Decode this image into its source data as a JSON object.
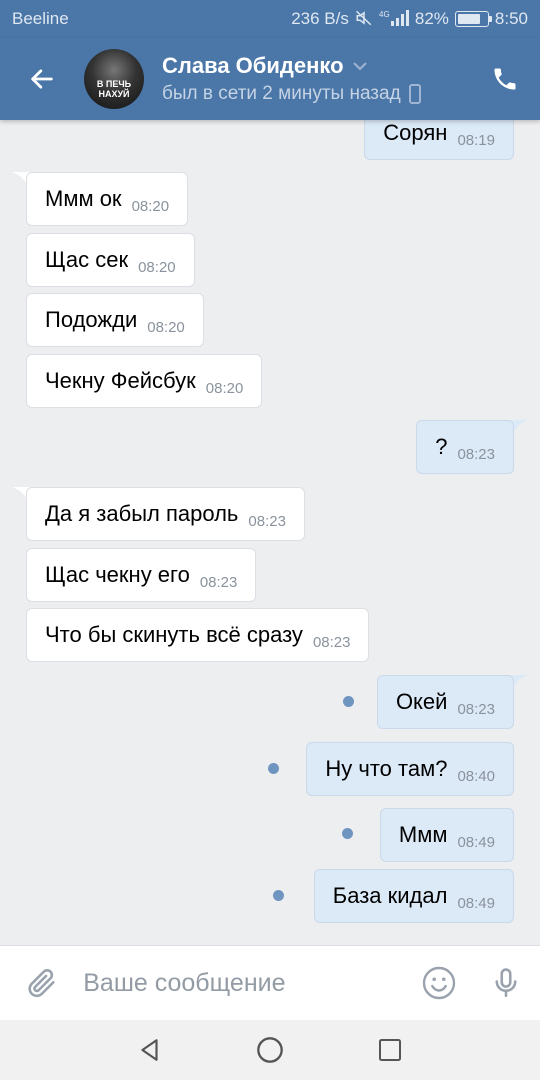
{
  "status_bar": {
    "carrier": "Beeline",
    "speed": "236 B/s",
    "network": "4G",
    "battery": "82%",
    "time": "8:50"
  },
  "header": {
    "contact_name": "Слава Обиденко",
    "contact_status": "был в сети 2 минуты назад",
    "avatar_text_line1": "В ПЕЧЬ",
    "avatar_text_line2": "НАХУЙ"
  },
  "messages": [
    {
      "direction": "out",
      "text": "Сорян",
      "time": "08:19"
    },
    {
      "direction": "in",
      "text": "Ммм ок",
      "time": "08:20"
    },
    {
      "direction": "in",
      "text": "Щас сек",
      "time": "08:20"
    },
    {
      "direction": "in",
      "text": "Подожди",
      "time": "08:20"
    },
    {
      "direction": "in",
      "text": "Чекну Фейсбук",
      "time": "08:20"
    },
    {
      "direction": "out",
      "text": "?",
      "time": "08:23"
    },
    {
      "direction": "in",
      "text": "Да я забыл пароль",
      "time": "08:23"
    },
    {
      "direction": "in",
      "text": "Щас чекну его",
      "time": "08:23"
    },
    {
      "direction": "in",
      "text": "Что бы скинуть всё сразу",
      "time": "08:23"
    },
    {
      "direction": "out",
      "text": "Окей",
      "time": "08:23",
      "unread": true
    },
    {
      "direction": "out",
      "text": "Ну что там?",
      "time": "08:40",
      "unread": true
    },
    {
      "direction": "out",
      "text": "Ммм",
      "time": "08:49",
      "unread": true
    },
    {
      "direction": "out",
      "text": "База кидал",
      "time": "08:49",
      "unread": true
    }
  ],
  "input": {
    "placeholder": "Ваше сообщение"
  },
  "icons": {
    "back": "arrow-left-icon",
    "phone": "phone-icon",
    "attach": "paperclip-icon",
    "emoji": "smiley-icon",
    "mic": "microphone-icon"
  },
  "colors": {
    "header": "#4a76a8",
    "bg": "#edeef0",
    "incoming": "#ffffff",
    "outgoing": "#dce9f7",
    "unread_dot": "#6f94c0"
  }
}
